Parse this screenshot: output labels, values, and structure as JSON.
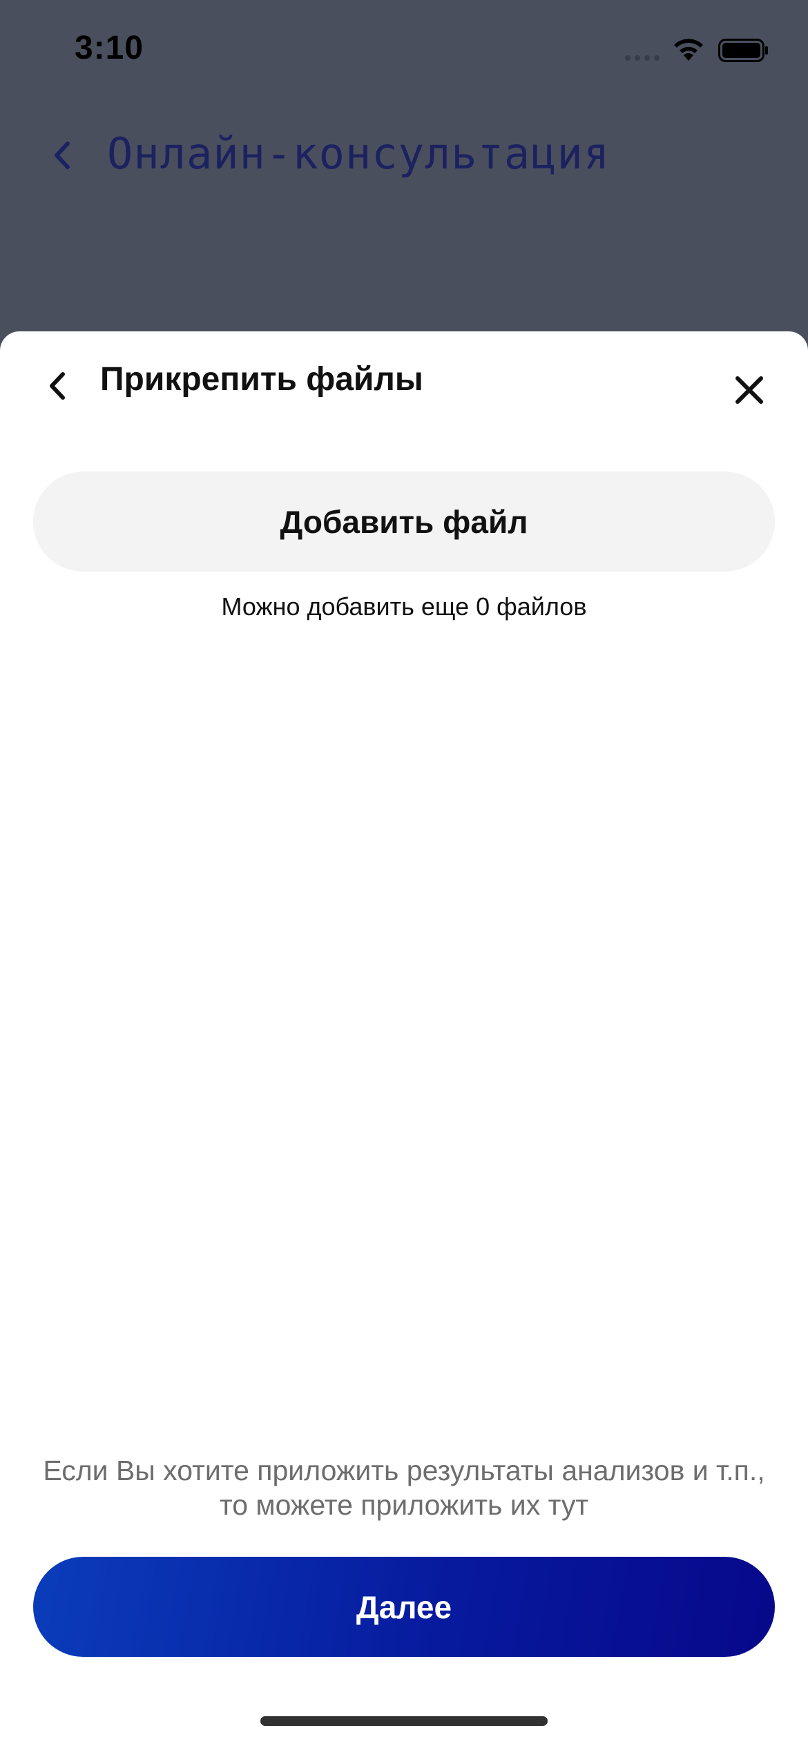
{
  "status_bar": {
    "time": "3:10",
    "icons": [
      "signal-dots-icon",
      "wifi-icon",
      "battery-icon"
    ]
  },
  "background_screen": {
    "title": "Онлайн-консультация",
    "back_icon": "chevron-left-icon"
  },
  "sheet": {
    "title": "Прикрепить файлы",
    "back_icon": "chevron-left-icon",
    "close_icon": "close-icon",
    "add_file_label": "Добавить файл",
    "files_left_text": "Можно добавить еще 0 файлов",
    "hint_text": "Если Вы хотите приложить результаты анализов и т.п., то можете приложить их тут",
    "next_label": "Далее"
  },
  "colors": {
    "overlay_background": "#4a4f5e",
    "background_title": "#1c2160",
    "sheet_background": "#ffffff",
    "secondary_button": "#f3f3f3",
    "primary_gradient_start": "#0a3dba",
    "primary_gradient_end": "#07088a",
    "hint_text": "#6d6d6d"
  }
}
